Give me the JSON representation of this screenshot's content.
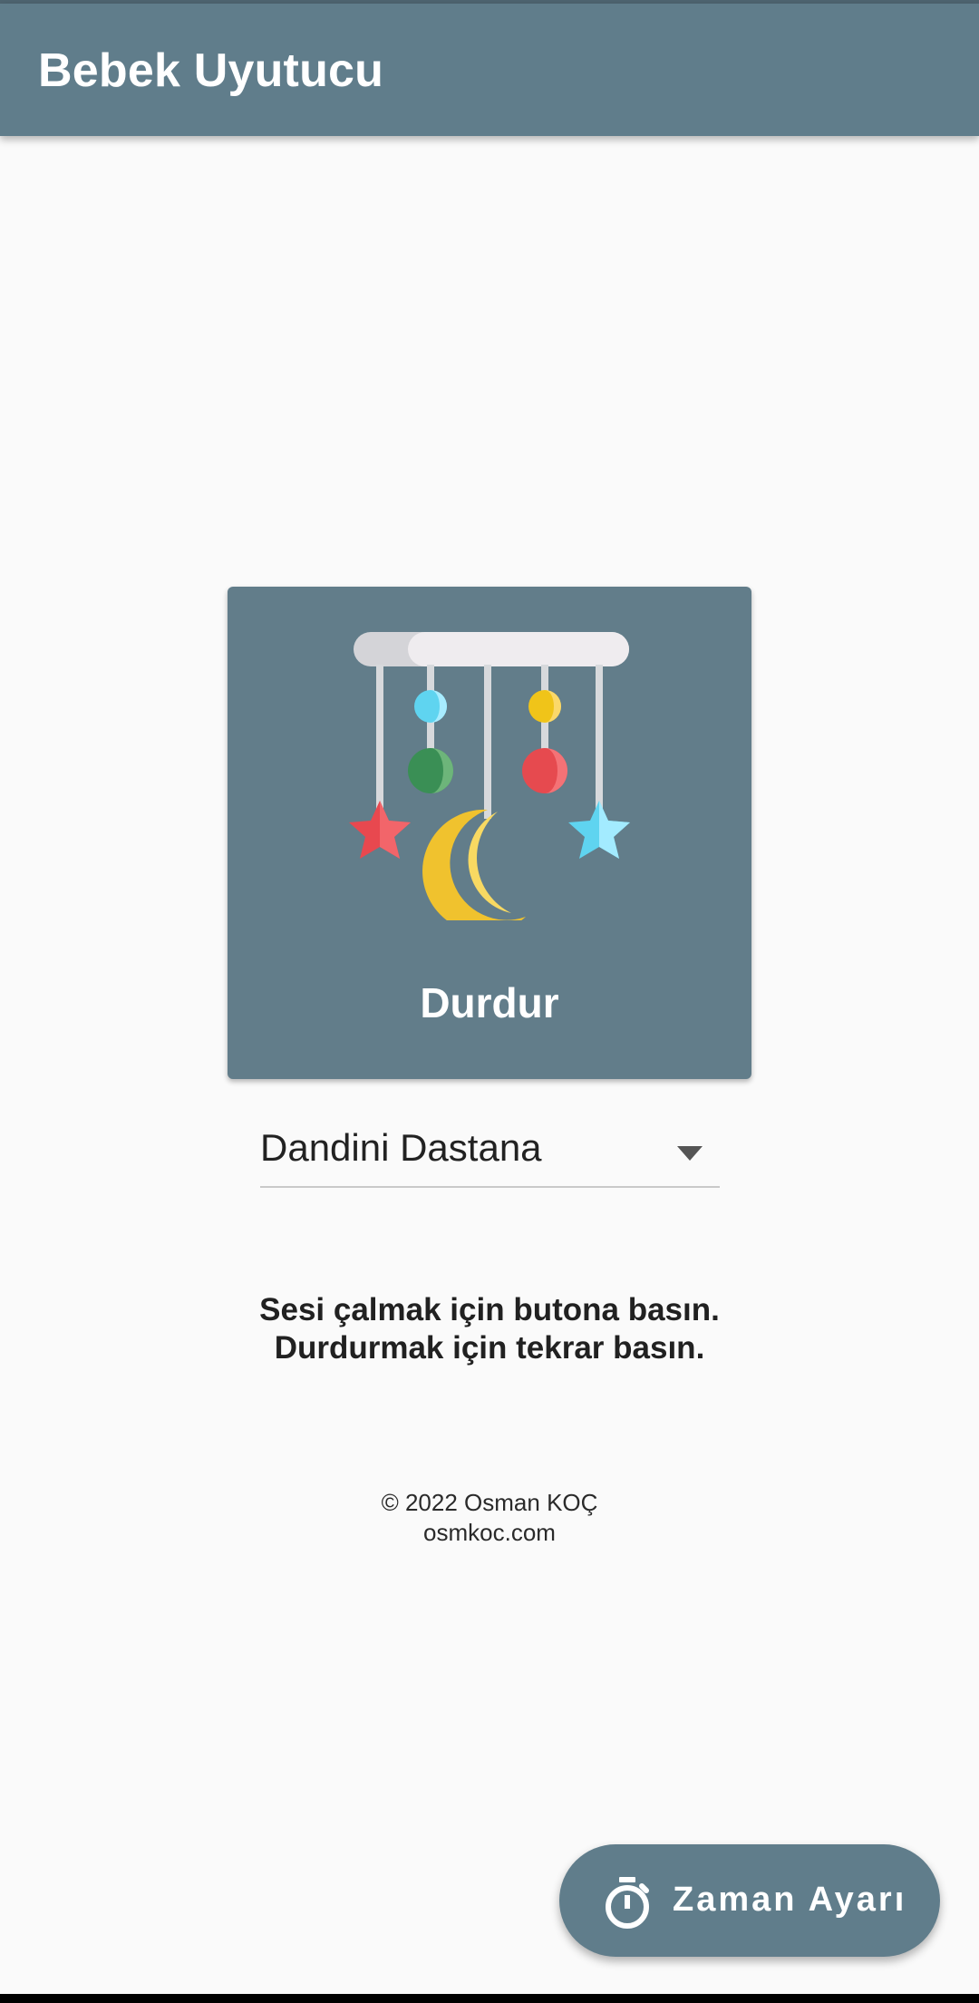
{
  "app_bar": {
    "title": "Bebek Uyutucu"
  },
  "player": {
    "button_label": "Durdur",
    "illustration": "baby-crib-mobile-icon"
  },
  "sound_select": {
    "selected": "Dandini Dastana",
    "icon": "dropdown-arrow-icon"
  },
  "instructions": {
    "line1": "Sesi çalmak için butona basın.",
    "line2": "Durdurmak için tekrar basın."
  },
  "credits": {
    "copyright": "© 2022 Osman KOÇ",
    "website": "osmkoc.com"
  },
  "fab": {
    "label": "Zaman Ayarı",
    "icon": "timer-icon"
  },
  "colors": {
    "primary": "#607d8b",
    "background": "#fafafa",
    "text": "#212121"
  }
}
